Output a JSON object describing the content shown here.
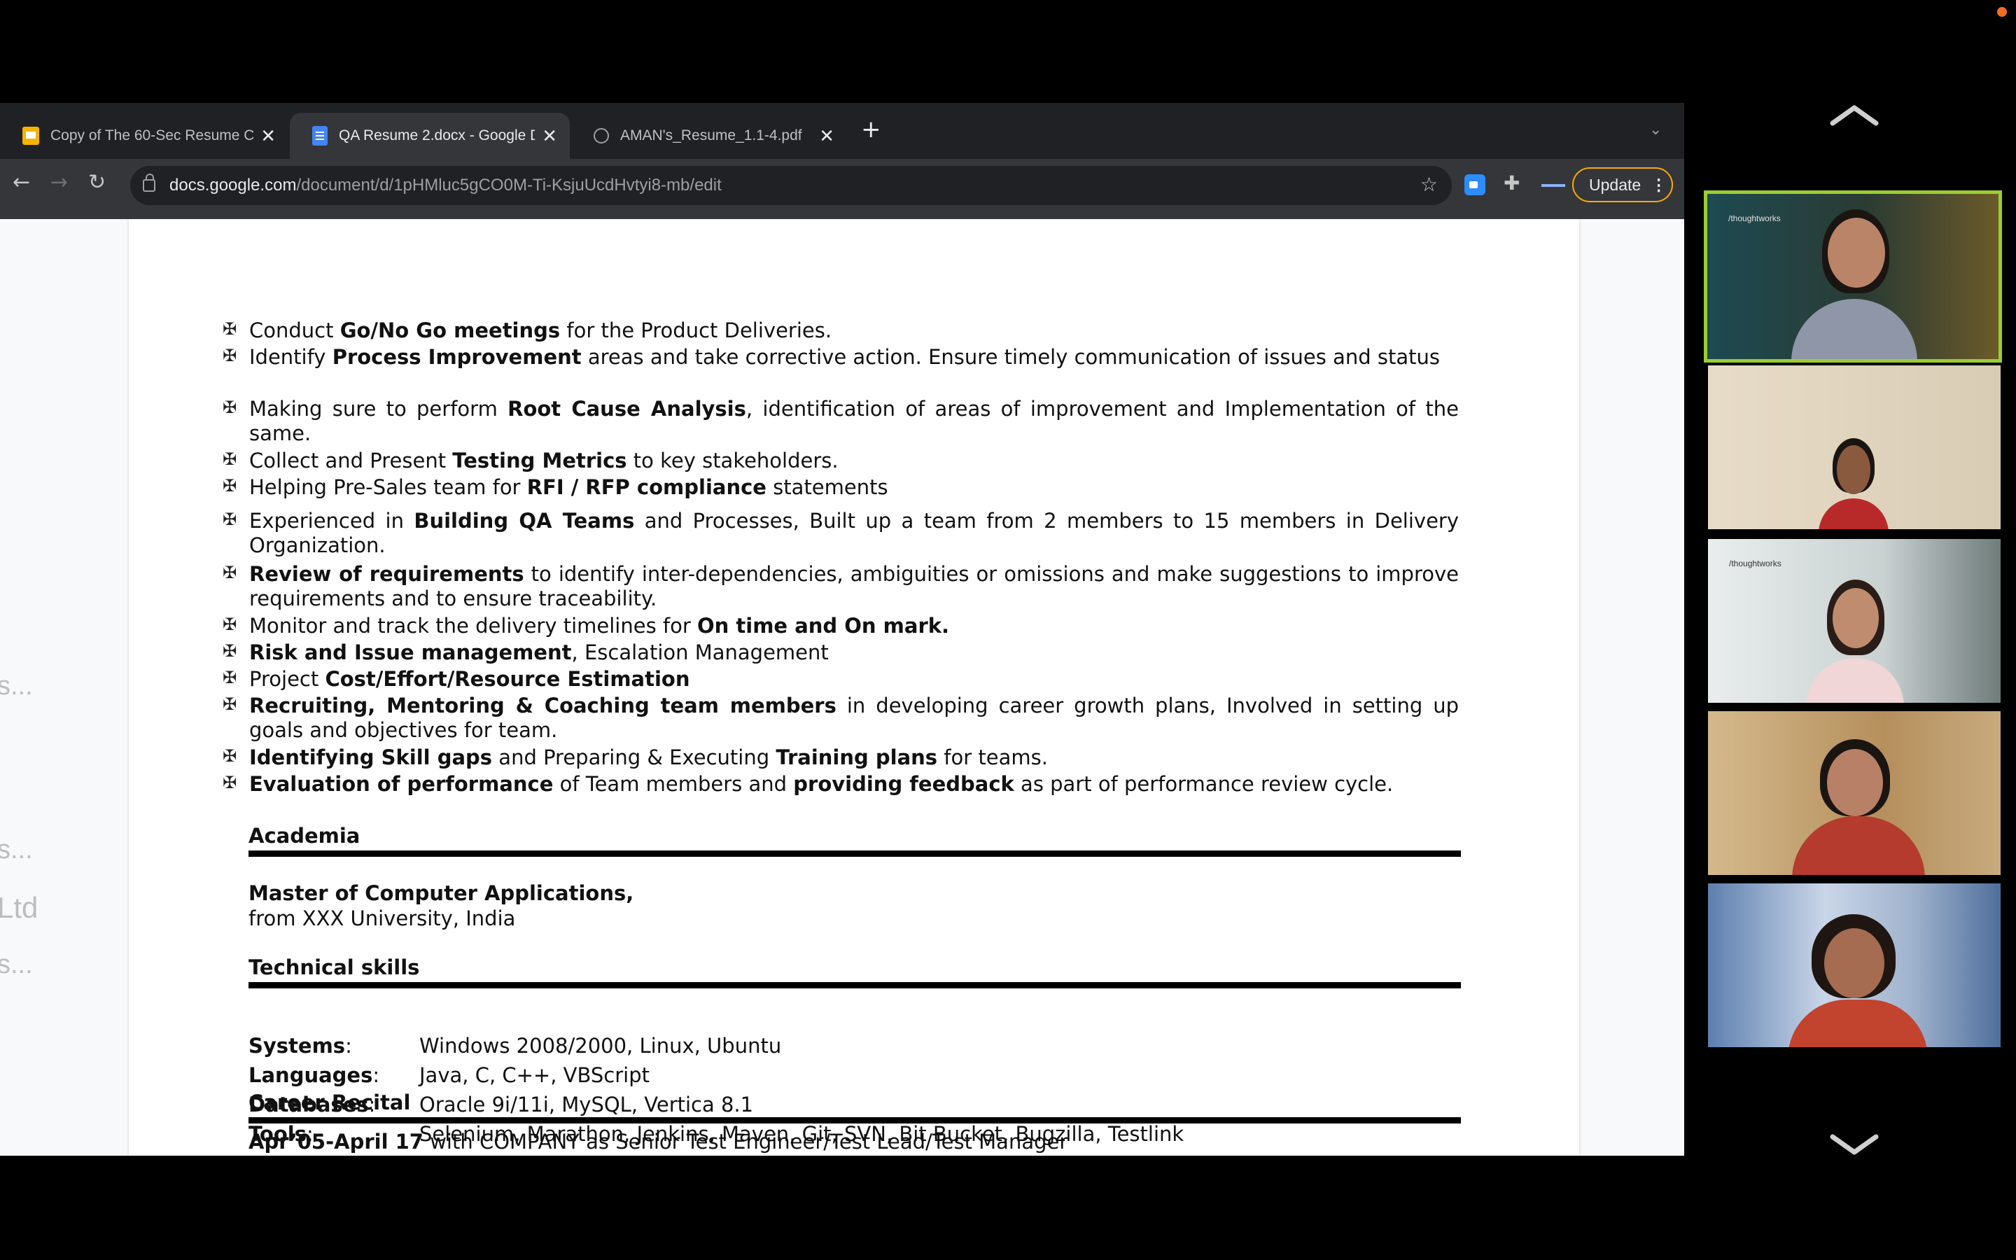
{
  "browser": {
    "tabs": [
      {
        "title": "Copy of The 60-Sec Resume C",
        "favicon": "slides-icon",
        "active": false
      },
      {
        "title": "QA Resume 2.docx - Google D",
        "favicon": "docs-icon",
        "active": true
      },
      {
        "title": "AMAN's_Resume_1.1-4.pdf",
        "favicon": "globe-icon",
        "active": false
      }
    ],
    "url_host": "docs.google.com",
    "url_path": "/document/d/1pHMluc5gCO0M-Ti-KsjuUcdHvtyi8-mb/edit",
    "update_label": "Update",
    "accent_update": "#f9ab00"
  },
  "side_ghost": [
    "s...",
    "s...",
    "Ltd",
    "s..."
  ],
  "doc": {
    "bullets": [
      {
        "pre": "Conduct ",
        "bold": "Go/No Go meetings",
        "post": " for the Product Deliveries."
      },
      {
        "pre": "Identify ",
        "bold": "Process Improvement",
        "post": " areas and take corrective action. Ensure timely communication of issues and status"
      },
      {
        "pre": "Making sure to perform ",
        "bold": "Root Cause Analysis",
        "post": ", identification of areas of improvement and Implementation of the same."
      },
      {
        "pre": "Collect and Present ",
        "bold": "Testing Metrics",
        "post": " to key stakeholders."
      },
      {
        "pre": "Helping Pre-Sales team for ",
        "bold": "RFI / RFP compliance",
        "post": " statements"
      },
      {
        "pre": "Experienced in ",
        "bold": "Building QA Teams",
        "post": " and Processes, Built up a team from 2 members to 15 members in Delivery Organization."
      },
      {
        "pre": "",
        "bold": "Review of requirements",
        "post": " to identify inter-dependencies, ambiguities or omissions and make suggestions to improve requirements and to ensure traceability."
      },
      {
        "pre": "Monitor and track the delivery timelines for ",
        "bold": "On time and On mark.",
        "post": ""
      },
      {
        "pre": "",
        "bold": "Risk and Issue management",
        "post": ", Escalation Management"
      },
      {
        "pre": "Project ",
        "bold": "Cost/Effort/Resource Estimation",
        "post": ""
      },
      {
        "pre": "",
        "bold": "Recruiting, Mentoring & Coaching team members",
        "post": " in developing career growth plans, Involved in setting up goals and objectives for team."
      },
      {
        "pre": "",
        "bold": "Identifying Skill gaps",
        "post": " and Preparing & Executing ",
        "bold2": "Training plans",
        "post2": " for teams."
      },
      {
        "pre": "",
        "bold": "Evaluation of performance",
        "post": " of Team members and ",
        "bold2": "providing feedback",
        "post2": " as part of performance review cycle."
      }
    ],
    "academia_heading": "Academia",
    "degree": "Master of Computer Applications,",
    "university": "from XXX University, India",
    "skills_heading": "Technical skills",
    "skills": [
      {
        "key": "Systems",
        "sep": ":",
        "value": "Windows 2008/2000, Linux, Ubuntu"
      },
      {
        "key": "Languages",
        "sep": ":",
        "value": "Java, C, C++, VBScript"
      },
      {
        "key": "Databases",
        "sep": ":",
        "value": "Oracle 9i/11i, MySQL, Vertica 8.1"
      },
      {
        "key": "Tools",
        "sep": ":",
        "value": "Selenium, Marathon, Jenkins, Maven, Git, SVN, Bit Bucket, Bugzilla, Testlink"
      }
    ],
    "career_heading": "Career Recital",
    "career_line_bold": "Apr’05-April 17",
    "career_line_rest": " with COMPANY as Senior Test Engineer/Test Lead/Test Manager"
  },
  "gallery": {
    "tiles": [
      {
        "name": "participant-1",
        "active": true,
        "logo": "/thoughtworks"
      },
      {
        "name": "participant-2",
        "active": false
      },
      {
        "name": "participant-3",
        "active": false,
        "logo": "/thoughtworks"
      },
      {
        "name": "participant-4",
        "active": false
      },
      {
        "name": "participant-5",
        "active": false
      }
    ],
    "active_border": "#9acd32"
  }
}
